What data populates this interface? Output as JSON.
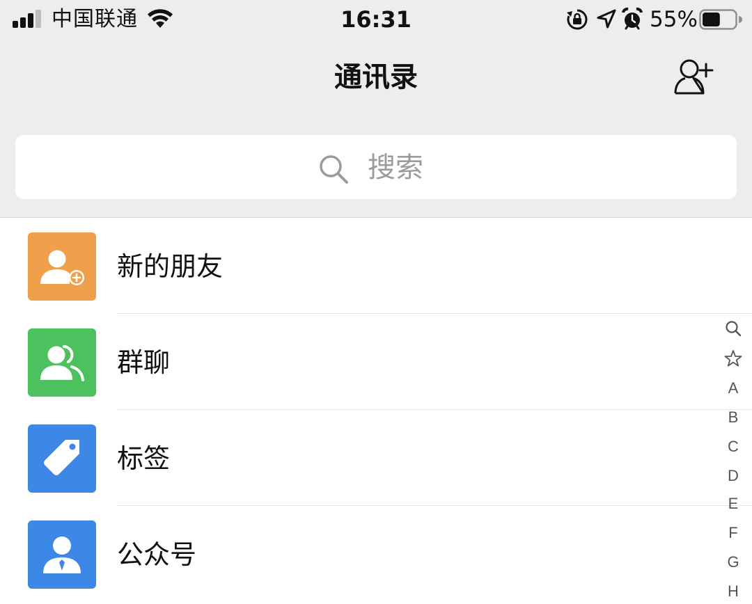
{
  "status_bar": {
    "carrier": "中国联通",
    "time": "16:31",
    "battery_percent": "55%",
    "battery_level": 0.55,
    "signal_bars": 3
  },
  "nav": {
    "title": "通讯录",
    "add_contact_icon": "add-contact-icon"
  },
  "search": {
    "placeholder": "搜索"
  },
  "items": [
    {
      "label": "新的朋友",
      "icon": "new-friend-icon",
      "color": "#f0a04a"
    },
    {
      "label": "群聊",
      "icon": "group-chat-icon",
      "color": "#4cc15e"
    },
    {
      "label": "标签",
      "icon": "tag-icon",
      "color": "#3d87e6"
    },
    {
      "label": "公众号",
      "icon": "official-account-icon",
      "color": "#3d87e6"
    }
  ],
  "index": {
    "icons": [
      "search-icon",
      "star-icon"
    ],
    "letters": [
      "A",
      "B",
      "C",
      "D",
      "E",
      "F",
      "G",
      "H"
    ]
  }
}
